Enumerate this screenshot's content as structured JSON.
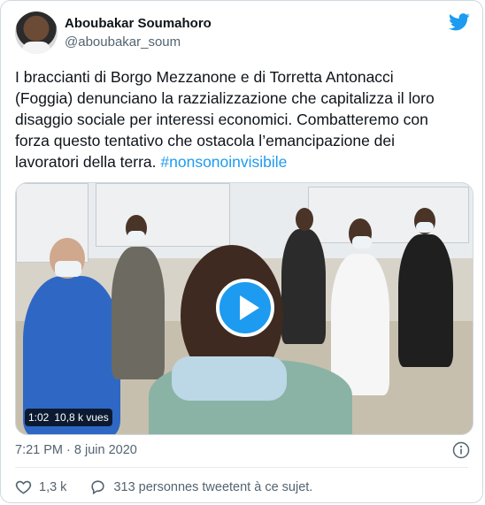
{
  "author": {
    "name": "Aboubakar Soumahoro",
    "handle": "@aboubakar_soum"
  },
  "tweet": {
    "text": "I braccianti di Borgo Mezzanone e di Torretta Antonacci\n(Foggia) denunciano la razzializzazione che capitalizza il loro\ndisaggio sociale per interessi economici. Combatteremo con\nforza questo tentativo che ostacola l’emancipazione dei\nlavoratori della terra. ",
    "hashtag": "#nonsonoinvisibile",
    "timestamp": "7:21 PM · 8 juin 2020"
  },
  "video": {
    "duration": "1:02",
    "views": "10,8 k vues"
  },
  "actions": {
    "likes": "1,3 k",
    "talking": "313 personnes tweetent à ce sujet."
  },
  "icons": {
    "brand": "twitter-bird-icon",
    "info": "info-icon",
    "like": "heart-icon",
    "reply": "speech-bubble-icon",
    "play": "play-icon"
  },
  "colors": {
    "accent": "#1d9bf0",
    "secondary_text": "#536471"
  }
}
